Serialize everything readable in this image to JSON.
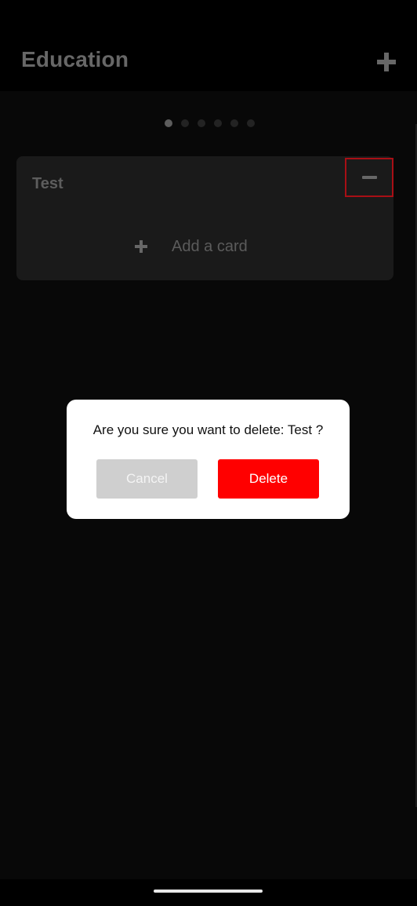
{
  "header": {
    "title": "Education",
    "add_icon": "plus-icon"
  },
  "pager": {
    "count": 6,
    "active_index": 0
  },
  "list": {
    "title": "Test",
    "remove_icon": "minus-icon",
    "add_card_label": "Add a card",
    "add_card_icon": "plus-icon"
  },
  "dialog": {
    "message": "Are you sure you want to delete: Test ?",
    "cancel_label": "Cancel",
    "delete_label": "Delete"
  },
  "colors": {
    "accent_delete": "#ff0000",
    "highlight_outline": "#e0141c",
    "background": "#0b0b0b",
    "card": "#232323"
  }
}
